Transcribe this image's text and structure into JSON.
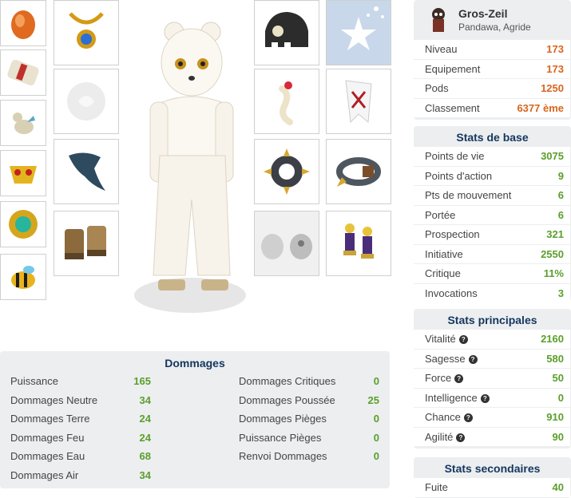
{
  "profile": {
    "name": "Gros-Zeil",
    "subtitle": "Pandawa, Agride",
    "rows": [
      {
        "label": "Niveau",
        "value": "173"
      },
      {
        "label": "Equipement",
        "value": "173"
      },
      {
        "label": "Pods",
        "value": "1250"
      },
      {
        "label": "Classement",
        "value": "6377 ème"
      }
    ]
  },
  "base_stats": {
    "title": "Stats de base",
    "rows": [
      {
        "label": "Points de vie",
        "value": "3075"
      },
      {
        "label": "Points d'action",
        "value": "9"
      },
      {
        "label": "Pts de mouvement",
        "value": "6"
      },
      {
        "label": "Portée",
        "value": "6"
      },
      {
        "label": "Prospection",
        "value": "321"
      },
      {
        "label": "Initiative",
        "value": "2550"
      },
      {
        "label": "Critique",
        "value": "11%"
      },
      {
        "label": "Invocations",
        "value": "3"
      }
    ]
  },
  "main_stats": {
    "title": "Stats principales",
    "rows": [
      {
        "label": "Vitalité",
        "value": "2160"
      },
      {
        "label": "Sagesse",
        "value": "580"
      },
      {
        "label": "Force",
        "value": "50"
      },
      {
        "label": "Intelligence",
        "value": "0"
      },
      {
        "label": "Chance",
        "value": "910"
      },
      {
        "label": "Agilité",
        "value": "90"
      }
    ]
  },
  "secondary_stats": {
    "title": "Stats secondaires",
    "rows": [
      {
        "label": "Fuite",
        "value": "40"
      }
    ]
  },
  "damages": {
    "title": "Dommages",
    "left": [
      {
        "label": "Puissance",
        "value": "165"
      },
      {
        "label": "Dommages Neutre",
        "value": "34"
      },
      {
        "label": "Dommages Terre",
        "value": "24"
      },
      {
        "label": "Dommages Feu",
        "value": "24"
      },
      {
        "label": "Dommages Eau",
        "value": "68"
      },
      {
        "label": "Dommages Air",
        "value": "34"
      }
    ],
    "right": [
      {
        "label": "Dommages Critiques",
        "value": "0"
      },
      {
        "label": "Dommages Poussée",
        "value": "25"
      },
      {
        "label": "Dommages Pièges",
        "value": "0"
      },
      {
        "label": "Puissance Pièges",
        "value": "0"
      },
      {
        "label": "Renvoi Dommages",
        "value": "0"
      }
    ]
  },
  "colors": {
    "title_blue": "#15365e",
    "value_green": "#5a9f2b",
    "value_orange": "#d9651d",
    "panel_bg": "#eceef0"
  }
}
